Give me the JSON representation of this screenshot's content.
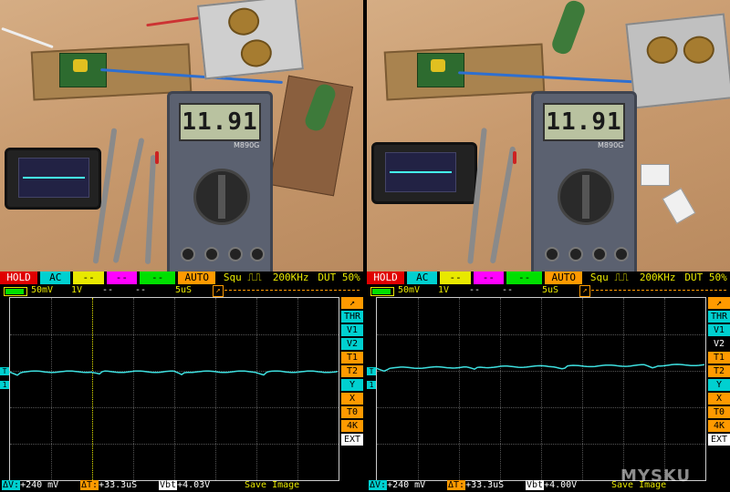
{
  "photos": {
    "left_multimeter_reading": "11.91",
    "right_multimeter_reading": "11.91",
    "multimeter_model": "M890G"
  },
  "scopes": [
    {
      "status": {
        "hold": "HOLD",
        "coupling": "AC",
        "ch2": "--",
        "ch3": "--",
        "ch4": "--",
        "mode": "AUTO",
        "wave": "Squ",
        "freq": "200KHz",
        "duty": "DUT 50%"
      },
      "bar2": {
        "volts": "50mV",
        "probe": "1V",
        "m1": "--",
        "m2": "--",
        "time": "5uS"
      },
      "side": [
        "THR",
        "V1",
        "V2",
        "T1",
        "T2",
        "Y",
        "X",
        "T0",
        "4K",
        "EXT"
      ],
      "bottom": {
        "dv_key": "ΔV:",
        "dv": "+240 mV",
        "dt_key": "ΔT:",
        "dt": "+33.3uS",
        "vbt_key": "Vbt",
        "vbt": "+4.03V",
        "save": "Save Image"
      }
    },
    {
      "status": {
        "hold": "HOLD",
        "coupling": "AC",
        "ch2": "--",
        "ch3": "--",
        "ch4": "--",
        "mode": "AUTO",
        "wave": "Squ",
        "freq": "200KHz",
        "duty": "DUT 50%"
      },
      "bar2": {
        "volts": "50mV",
        "probe": "1V",
        "m1": "--",
        "m2": "--",
        "time": "5uS"
      },
      "side": [
        "THR",
        "V1",
        "V2",
        "T1",
        "T2",
        "Y",
        "X",
        "T0",
        "4K",
        "EXT"
      ],
      "bottom": {
        "dv_key": "ΔV:",
        "dv": "+240 mV",
        "dt_key": "ΔT:",
        "dt": "+33.3uS",
        "vbt_key": "Vbt",
        "vbt": "+4.00V",
        "save": "Save Image"
      }
    }
  ],
  "watermark": "MYSKU",
  "colors": {
    "trace": "#3ee0e0",
    "hold": "#e00000",
    "accent": "#ff9a00",
    "label": "#e8e800"
  }
}
